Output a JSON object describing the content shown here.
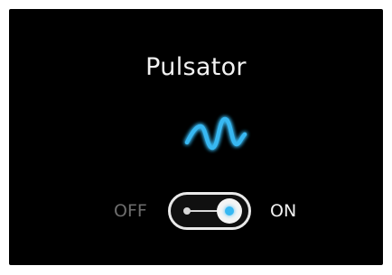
{
  "panel": {
    "title": "Pulsator",
    "icon": "pulse-wave-icon",
    "accent_color": "#37b8f2"
  },
  "toggle": {
    "off_label": "OFF",
    "on_label": "ON",
    "state": "on"
  }
}
